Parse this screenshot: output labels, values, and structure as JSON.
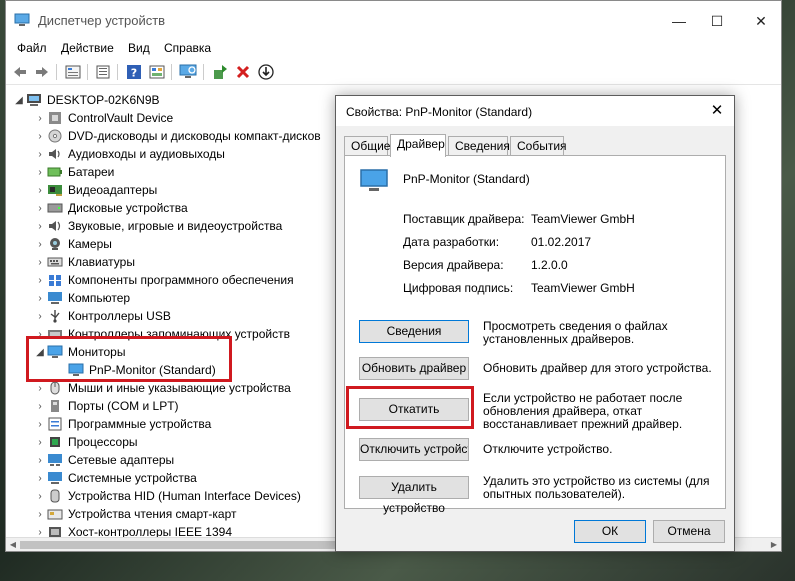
{
  "window": {
    "title": "Диспетчер устройств",
    "minimize": "—",
    "maximize": "☐",
    "close": "✕"
  },
  "menu": [
    "Файл",
    "Действие",
    "Вид",
    "Справка"
  ],
  "toolbar_icons": [
    "back-icon",
    "forward-icon",
    "properties-icon",
    "view-icon",
    "help-icon",
    "show-hidden-icon",
    "scan-hardware-icon",
    "update-driver-icon",
    "uninstall-icon",
    "disable-icon"
  ],
  "tree": {
    "root": "DESKTOP-02K6N9B",
    "items": [
      "ControlVault Device",
      "DVD-дисководы и дисководы компакт-дисков",
      "Аудиовходы и аудиовыходы",
      "Батареи",
      "Видеоадаптеры",
      "Дисковые устройства",
      "Звуковые, игровые и видеоустройства",
      "Камеры",
      "Клавиатуры",
      "Компоненты программного обеспечения",
      "Компьютер",
      "Контроллеры USB",
      "Контроллеры запоминающих устройств",
      "Мониторы",
      "PnP-Monitor (Standard)",
      "Мыши и иные указывающие устройства",
      "Порты (COM и LPT)",
      "Программные устройства",
      "Процессоры",
      "Сетевые адаптеры",
      "Системные устройства",
      "Устройства HID (Human Interface Devices)",
      "Устройства чтения смарт-карт",
      "Хост-контроллеры IEEE 1394"
    ]
  },
  "dialog": {
    "title": "Свойства: PnP-Monitor (Standard)",
    "close": "✕",
    "tabs": [
      "Общие",
      "Драйвер",
      "Сведения",
      "События"
    ],
    "active_tab": "Драйвер",
    "device_name": "PnP-Monitor (Standard)",
    "props": [
      {
        "label": "Поставщик драйвера:",
        "value": "TeamViewer GmbH"
      },
      {
        "label": "Дата разработки:",
        "value": "01.02.2017"
      },
      {
        "label": "Версия драйвера:",
        "value": "1.2.0.0"
      },
      {
        "label": "Цифровая подпись:",
        "value": "TeamViewer GmbH"
      }
    ],
    "buttons": [
      {
        "label": "Сведения",
        "desc": "Просмотреть сведения о файлах установленных драйверов."
      },
      {
        "label": "Обновить драйвер",
        "desc": "Обновить драйвер для этого устройства."
      },
      {
        "label": "Откатить",
        "desc": "Если устройство не работает после обновления драйвера, откат восстанавливает прежний драйвер."
      },
      {
        "label": "Отключить устройство",
        "desc": "Отключите устройство."
      },
      {
        "label": "Удалить устройство",
        "desc": "Удалить это устройство из системы (для опытных пользователей)."
      }
    ],
    "ok": "ОК",
    "cancel": "Отмена"
  },
  "colors": {
    "highlight": "#d0191f",
    "accent": "#0078d7"
  }
}
